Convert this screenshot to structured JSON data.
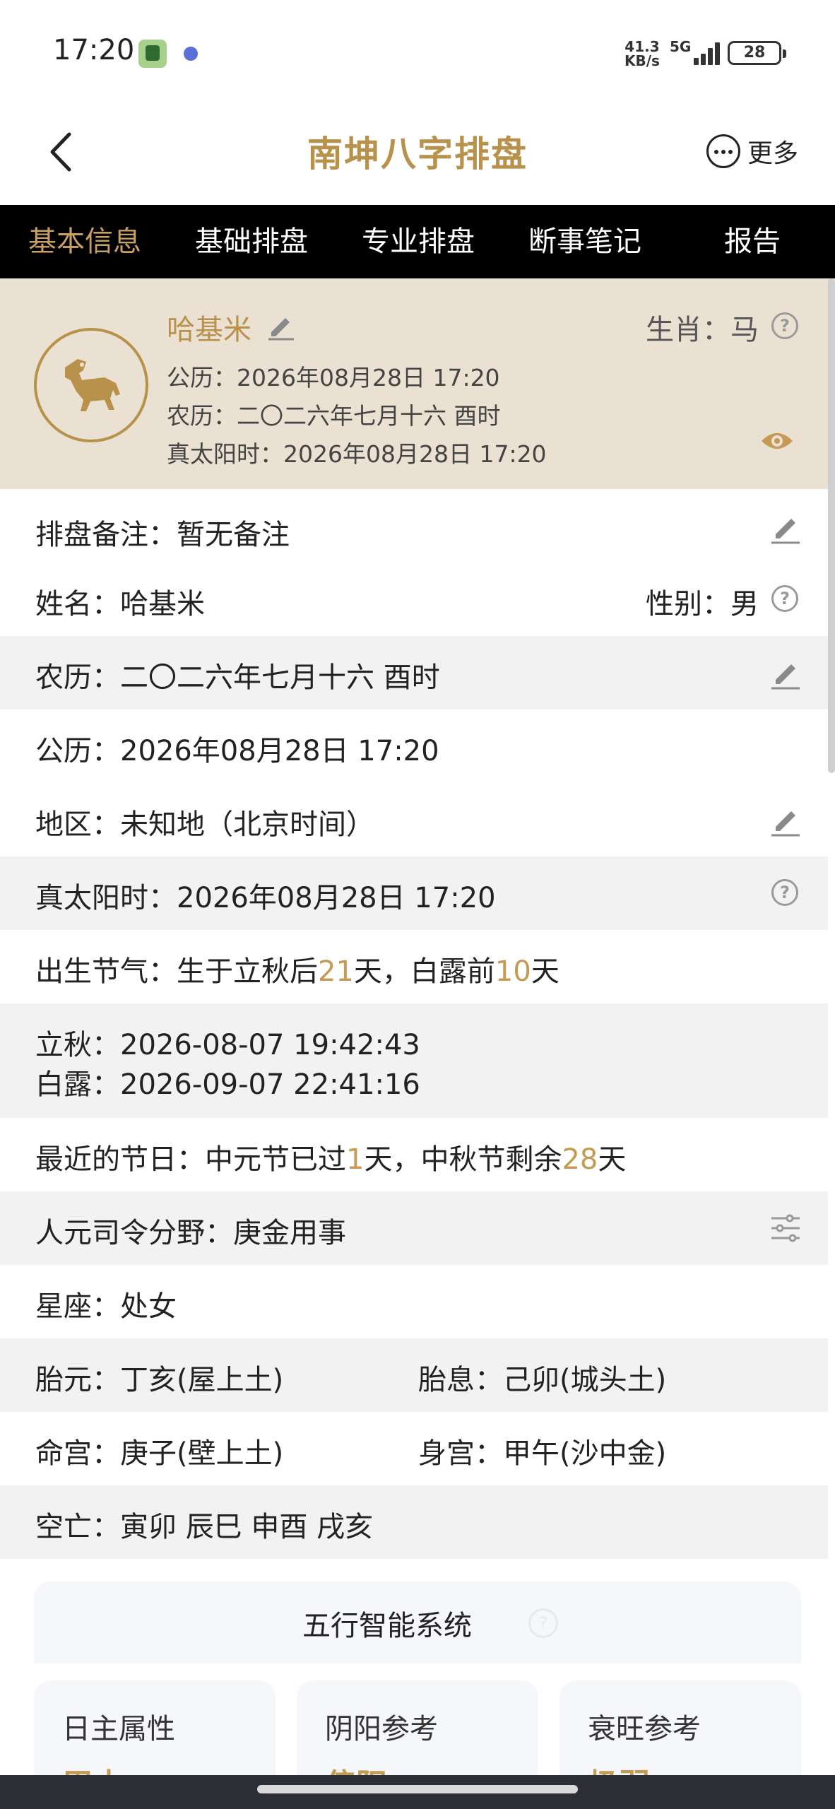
{
  "status_bar": {
    "time": "17:20",
    "net_speed_value": "41.3",
    "net_speed_unit": "KB/s",
    "network": "5G",
    "battery": "28"
  },
  "header": {
    "title": "南坤八字排盘",
    "more_label": "更多"
  },
  "tabs": [
    "基本信息",
    "基础排盘",
    "专业排盘",
    "断事笔记",
    "报告"
  ],
  "profile": {
    "name": "哈基米",
    "zodiac": "生肖：马",
    "solar": "公历：2026年08月28日 17:20",
    "lunar": "农历：二〇二六年七月十六  酉时",
    "true_solar": "真太阳时：2026年08月28日 17:20",
    "avatar_icon": "horse-zodiac-icon"
  },
  "rows": {
    "note": "排盘备注：暂无备注",
    "name": "姓名：哈基米",
    "gender": "性别：男",
    "lunar": "农历：二〇二六年七月十六  酉时",
    "solar": "公历：2026年08月28日 17:20",
    "region": "地区：未知地（北京时间）",
    "true_solar": "真太阳时：2026年08月28日 17:20",
    "jieqi_prefix": "出生节气：生于立秋后",
    "jieqi_days_after": "21",
    "jieqi_mid": "天，白露前",
    "jieqi_days_before": "10",
    "jieqi_suffix": "天",
    "liqiu": "立秋：2026-08-07 19:42:43",
    "bailu": "白露：2026-09-07 22:41:16",
    "festival_prefix": "最近的节日：中元节已过",
    "festival_passed": "1",
    "festival_mid": "天，中秋节剩余",
    "festival_remaining": "28",
    "festival_suffix": "天",
    "renyuan": "人元司令分野：庚金用事",
    "xingzuo": "星座：处女",
    "taiyuan": "胎元：丁亥(屋上土)",
    "taixi": "胎息：己卯(城头土)",
    "minggong": "命宫：庚子(壁上土)",
    "shengong": "身宫：甲午(沙中金)",
    "kongwang": "空亡：寅卯 辰巳 申酉 戌亥"
  },
  "wuxing": {
    "title": "五行智能系统",
    "cards": [
      {
        "title": "日主属性",
        "value": "甲木"
      },
      {
        "title": "阴阳参考",
        "value": "偏阳"
      },
      {
        "title": "衰旺参考",
        "value": "极弱"
      }
    ]
  },
  "colors": {
    "accent": "#b8914a",
    "highlight": "#c49a55",
    "tab_bar": "#000000",
    "profile_bg": "#ebe1d2",
    "row_gray": "#f2f2f2"
  }
}
